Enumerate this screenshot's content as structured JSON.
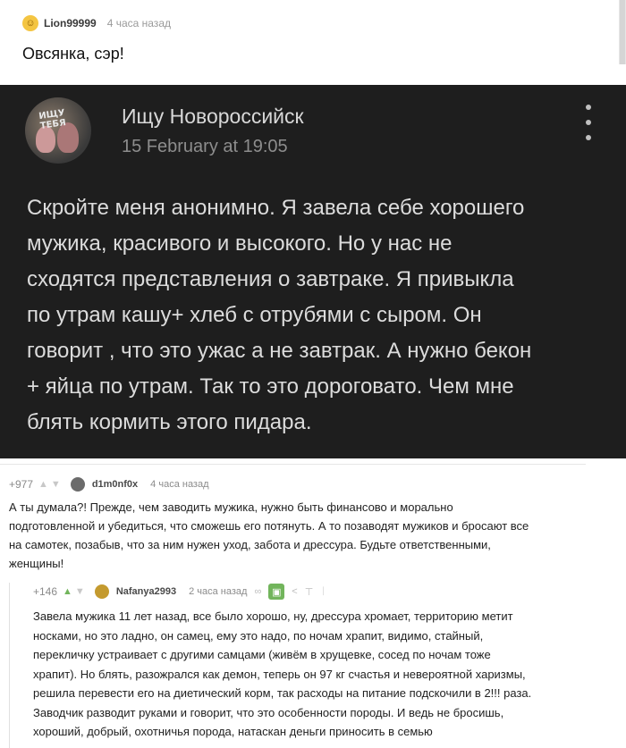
{
  "top_comment": {
    "username": "Lion99999",
    "time": "4 часа назад",
    "text": "Овсянка, сэр!"
  },
  "post_screenshot": {
    "author": "Ищу Новороссийск",
    "date": "15 February at 19:05",
    "avatar_text": "ИЩУ ТЕБЯ",
    "body_lines": [
      "Скройте меня анонимно. Я завела себе хорошего",
      "мужика, красивого и высокого. Но у нас не",
      "сходятся представления о завтраке. Я привыкла",
      "по утрам кашу+ хлеб с отрубями с сыром. Он",
      "говорит , что это ужас а не завтрак. А нужно бекон",
      "+ яйца по утрам. Так то это дороговато. Чем мне",
      "блять  кормить этого пидара."
    ]
  },
  "comments": [
    {
      "rating": "+977",
      "username": "d1m0nf0x",
      "time": "4 часа назад",
      "lines": [
        "А ты думала?! Прежде, чем заводить мужика, нужно быть финансово и морально",
        "подготовленной и убедиться, что сможешь его потянуть. А то позаводят мужиков и бросают все",
        "на самотек, позабыв, что за ним нужен уход, забота и дрессура. Будьте ответственными,",
        "женщины!"
      ]
    },
    {
      "rating": "+146",
      "username": "Nafanya2993",
      "time": "2 часа назад",
      "lines": [
        "Завела мужика 11 лет назад, все было хорошо, ну, дрессура хромает, территорию метит",
        "носками, но это ладно, он самец, ему это надо, по ночам храпит, видимо, стайный,",
        "перекличку устраивает с другими самцами (живём в хрущевке, сосед по ночам тоже",
        "храпит). Но блять, разожрался как демон, теперь он 97 кг счастья и невероятной харизмы,",
        "решила перевести его на диетический корм, так расходы на питание подскочили в 2!!! раза.",
        "Заводчик разводит руками и говорит, что это особенности породы. И ведь не бросишь,",
        "хороший, добрый, охотничья порода, натаскан деньги приносить в семью"
      ]
    }
  ],
  "colors": {
    "dark_bg": "#1e1e1e",
    "upvote_green": "#72b55c"
  }
}
